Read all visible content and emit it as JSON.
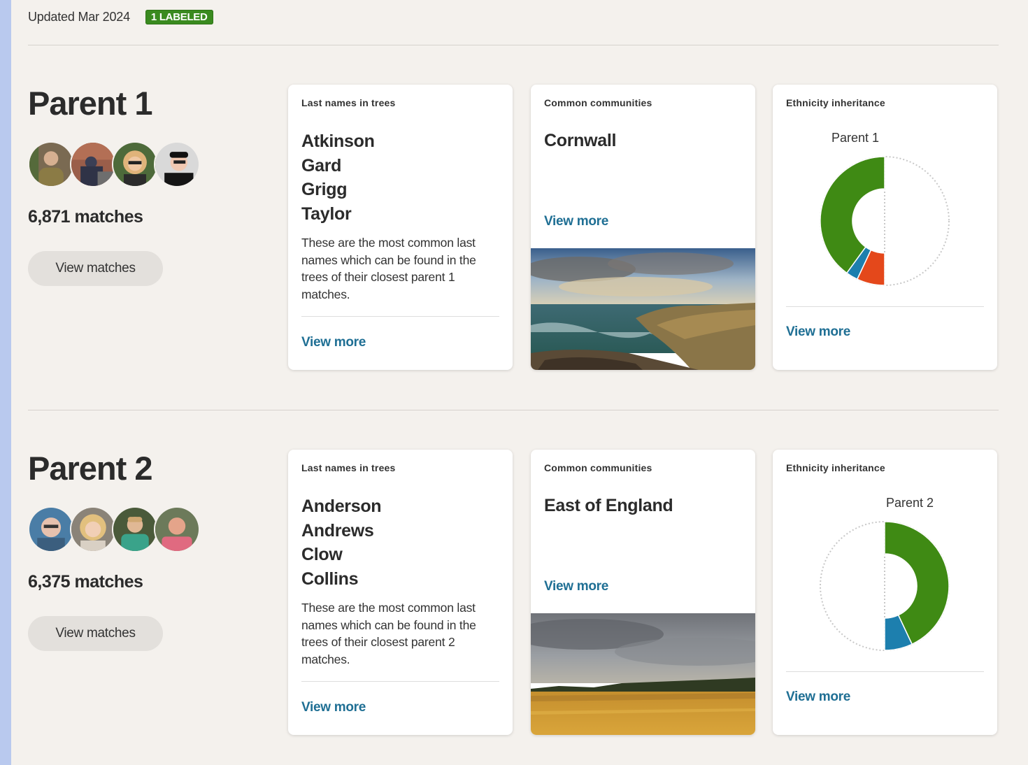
{
  "header": {
    "updated": "Updated Mar 2024",
    "badge": "1 LABELED"
  },
  "parent1": {
    "title": "Parent 1",
    "matches": "6,871 matches",
    "view_matches": "View matches",
    "last_names": {
      "label": "Last names in trees",
      "names": [
        "Atkinson",
        "Gard",
        "Grigg",
        "Taylor"
      ],
      "description": "These are the most common last names which can be found in the trees of their closest parent 1 matches.",
      "view_more": "View more"
    },
    "communities": {
      "label": "Common communities",
      "name": "Cornwall",
      "view_more": "View more",
      "photo": "cornwall-coastline-photo"
    },
    "ethnicity": {
      "label": "Ethnicity inheritance",
      "donut_label": "Parent 1",
      "view_more": "View more",
      "side": "left",
      "segments": [
        {
          "name": "green",
          "color": "#3f8a14",
          "fraction": 0.8
        },
        {
          "name": "blue",
          "color": "#1d7fae",
          "fraction": 0.06
        },
        {
          "name": "orange",
          "color": "#e4481b",
          "fraction": 0.14
        }
      ]
    }
  },
  "parent2": {
    "title": "Parent 2",
    "matches": "6,375 matches",
    "view_matches": "View matches",
    "last_names": {
      "label": "Last names in trees",
      "names": [
        "Anderson",
        "Andrews",
        "Clow",
        "Collins"
      ],
      "description": "These are the most common last names which can be found in the trees of their closest parent 2 matches.",
      "view_more": "View more"
    },
    "communities": {
      "label": "Common communities",
      "name": "East of England",
      "view_more": "View more",
      "photo": "east-of-england-field-photo"
    },
    "ethnicity": {
      "label": "Ethnicity inheritance",
      "donut_label": "Parent 2",
      "view_more": "View more",
      "side": "right",
      "segments": [
        {
          "name": "green",
          "color": "#3f8a14",
          "fraction": 0.86
        },
        {
          "name": "blue",
          "color": "#1d7fae",
          "fraction": 0.14
        }
      ]
    }
  }
}
